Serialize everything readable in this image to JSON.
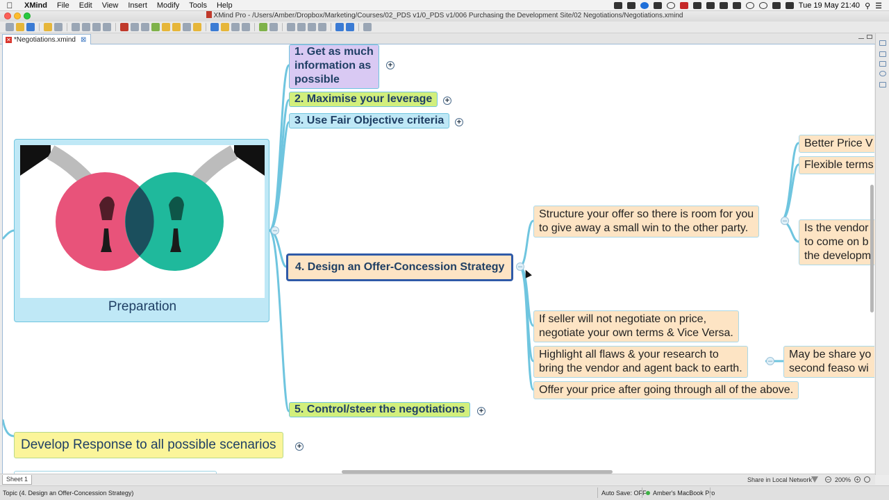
{
  "menubar": {
    "app_name": "XMind",
    "items": [
      "File",
      "Edit",
      "View",
      "Insert",
      "Modify",
      "Tools",
      "Help"
    ],
    "clock": "Tue 19 May  21:40"
  },
  "window": {
    "title": "XMind Pro - /Users/Amber/Dropbox/Marketing/Courses/02_PDS v1/0_PDS v1/006 Purchasing the Development Site/02 Negotiations/Negotiations.xmind"
  },
  "editor_tab": {
    "label": "*Negotiations.xmind"
  },
  "central_topic": {
    "label": "Preparation"
  },
  "topics": [
    {
      "label": "1. Get as much\ninformation as\npossible",
      "color": "#d9c9f3"
    },
    {
      "label": "2. Maximise your leverage",
      "color": "#d2ef7c"
    },
    {
      "label": "3. Use Fair Objective criteria",
      "color": "#bfe8f6"
    },
    {
      "label": "4. Design an Offer-Concession Strategy",
      "color": "#fde4c4"
    },
    {
      "label": "5. Control/steer the negotiations",
      "color": "#d2ef7c"
    }
  ],
  "develop_topic": {
    "label": "Develop Response to all possible scenarios",
    "color": "#fbf59a"
  },
  "subtopics": [
    "Structure your offer so there is room for you\nto give away a small win to the other party.",
    "If seller will not negotiate on price,\nnegotiate your own terms & Vice Versa.",
    "Highlight all flaws & your research to\nbring the vendor and agent back to earth.",
    "Offer your price after going through all of the above."
  ],
  "right_nodes": [
    "Better Price V",
    "Flexible terms",
    "Is the vendor\nto come on b\nthe developm",
    "May be share yo\nsecond feaso wi"
  ],
  "sheet_bar": {
    "sheet": "Sheet 1",
    "share": "Share in Local Network",
    "zoom": "200%"
  },
  "status_bar": {
    "selection": "Topic (4. Design an Offer-Concession Strategy)",
    "autosave": "Auto Save: OFF",
    "network": "Amber's MacBook Pro"
  },
  "colors": {
    "branch_line": "#6fc5df",
    "selection": "#2f5aa8",
    "circle_pink": "#e8537a",
    "circle_teal": "#1fb99c"
  }
}
